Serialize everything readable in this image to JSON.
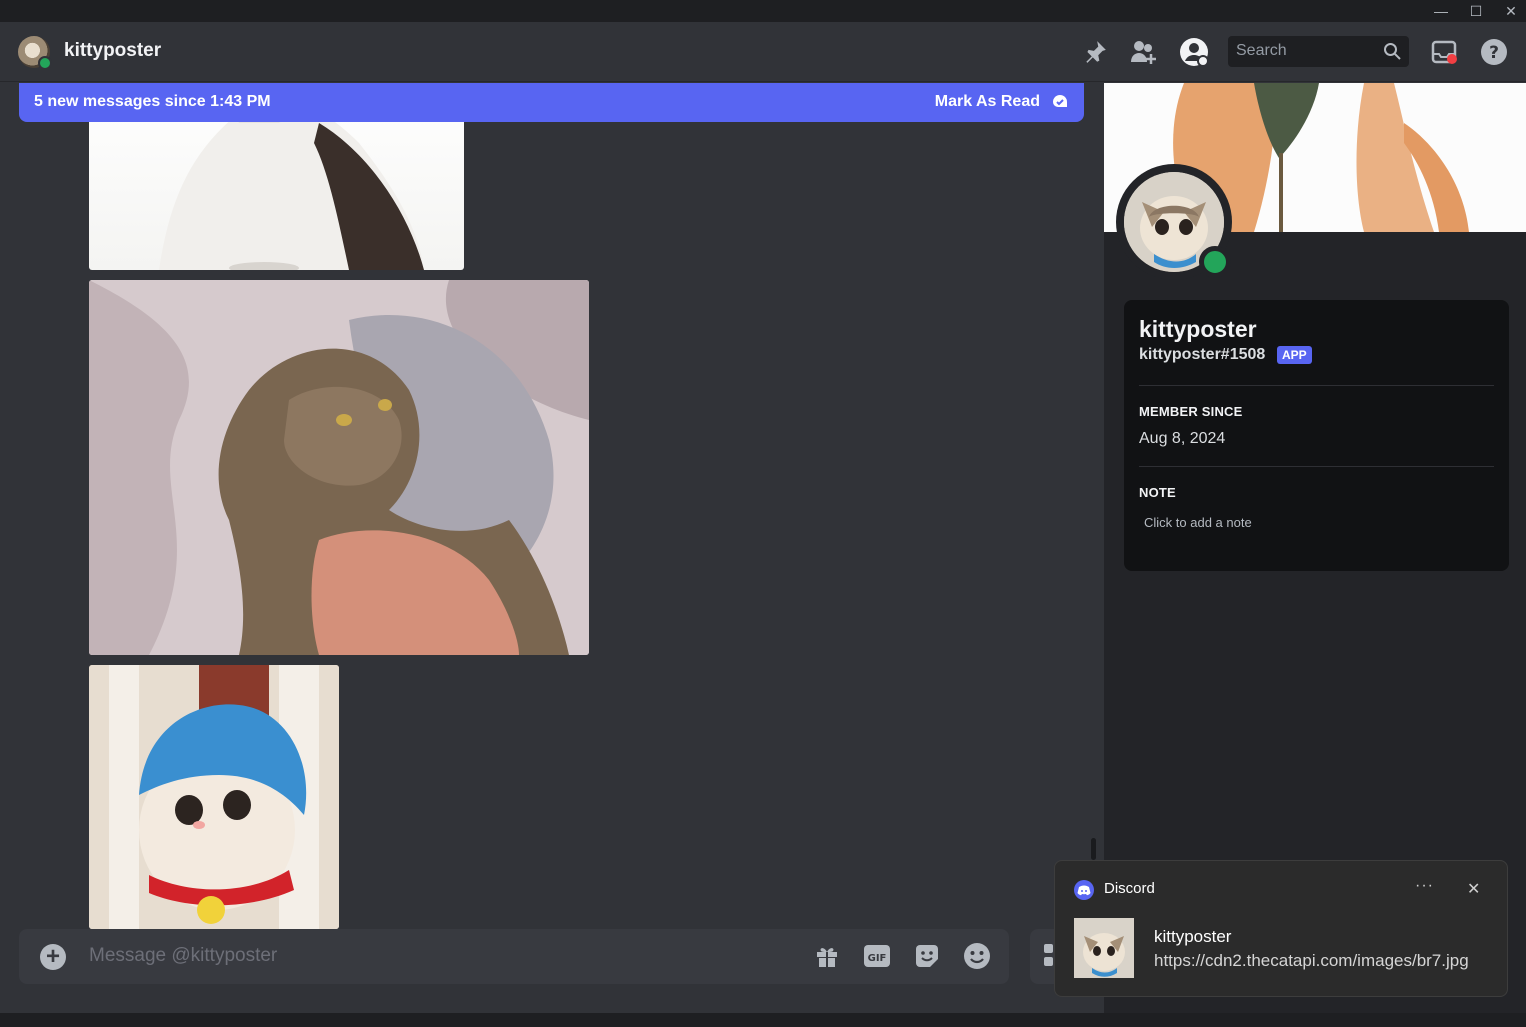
{
  "window": {
    "controls": {
      "minimize": "—",
      "maximize": "☐",
      "close": "✕"
    }
  },
  "header": {
    "username": "kittyposter",
    "search_placeholder": "Search",
    "icons": [
      "pin-icon",
      "add-friends-icon",
      "user-profile-icon",
      "search-icon",
      "inbox-icon",
      "help-icon"
    ]
  },
  "chat": {
    "banner_text": "5 new messages since 1:43 PM",
    "mark_as_read": "Mark As Read",
    "composer_placeholder": "Message @kittyposter",
    "composer_icons": [
      "gift-icon",
      "gif-icon",
      "sticker-icon",
      "emoji-icon"
    ],
    "gif_label": "GIF"
  },
  "profile": {
    "name": "kittyposter",
    "tag": "kittyposter#1508",
    "badge": "APP",
    "member_since_label": "MEMBER SINCE",
    "member_since_value": "Aug 8, 2024",
    "note_label": "NOTE",
    "note_placeholder": "Click to add a note"
  },
  "notification": {
    "app": "Discord",
    "more": "···",
    "close": "✕",
    "title": "kittyposter",
    "body": "https://cdn2.thecatapi.com/images/br7.jpg"
  },
  "colors": {
    "accent": "#5865f2",
    "online": "#23a55a",
    "background": "#313338",
    "panel": "#232428"
  }
}
